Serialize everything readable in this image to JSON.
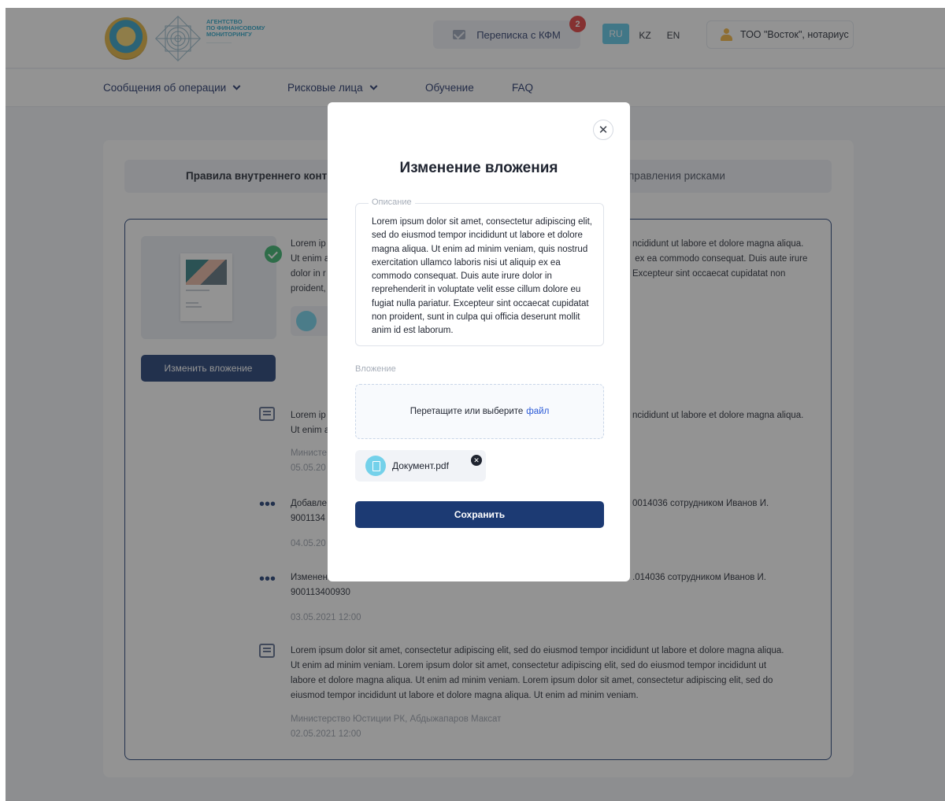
{
  "header": {
    "agency_lines": [
      "АГЕНТСТВО",
      "ПО ФИНАНСОВОМУ",
      "МОНИТОРИНГУ"
    ],
    "kfm_button": "Переписка с КФМ",
    "kfm_badge": "2",
    "languages": {
      "ru": "RU",
      "kz": "KZ",
      "en": "EN",
      "active": "RU"
    },
    "profile": "ТОО \"Восток\", нотариус"
  },
  "nav": {
    "items": [
      {
        "label": "Сообщения об операции"
      },
      {
        "label": "Рисковые лица"
      },
      {
        "label": "Обучение"
      },
      {
        "label": "FAQ"
      }
    ]
  },
  "content": {
    "tab_left": "Правила внутреннего контр",
    "tab_right": "правления рисками",
    "change_button": "Изменить вложение",
    "entries": [
      {
        "left": "Lorem ip\nUt enim a\ndolor in r\nproident,",
        "right": "ncididunt ut labore et dolore magna aliqua.\n ex ea commodo consequat. Duis aute irure\nExcepteur sint occaecat cupidatat non"
      },
      {
        "left": "Lorem ip\nUt enim a",
        "right": "ncididunt ut labore et dolore magna aliqua.",
        "meta": "Министе\n05.05.20"
      },
      {
        "left": "Добавле\n9001134",
        "right": "0014036 сотрудником Иванов И.",
        "meta": "04.05.20"
      },
      {
        "left": "Изменен\n900113400930",
        "right": ".014036 сотрудником Иванов И.",
        "meta": "03.05.2021 12:00"
      },
      {
        "text": "Lorem ipsum dolor sit amet, consectetur adipiscing elit, sed do eiusmod tempor incididunt ut labore et dolore magna aliqua.\nUt enim ad minim veniam. Lorem ipsum dolor sit amet, consectetur adipiscing elit, sed do eiusmod tempor incididunt ut\nlabore et dolore magna aliqua. Ut enim ad minim veniam. Lorem ipsum dolor sit amet, consectetur adipiscing elit, sed do\neiusmod tempor incididunt ut labore et dolore magna aliqua. Ut enim ad minim veniam.",
        "meta": "Министерство Юстиции РК, Абдыжапаров Максат\n02.05.2021 12:00"
      }
    ]
  },
  "modal": {
    "title": "Изменение вложения",
    "description_label": "Описание",
    "description_text": "Lorem ipsum dolor sit amet, consectetur adipiscing elit, sed do eiusmod tempor incididunt ut labore et dolore magna aliqua. Ut enim ad minim veniam, quis nostrud exercitation ullamco laboris nisi ut aliquip ex ea commodo consequat. Duis aute irure dolor in reprehenderit in voluptate velit esse cillum dolore eu fugiat nulla pariatur. Excepteur sint occaecat cupidatat non proident, sunt in culpa qui officia deserunt mollit anim id est laborum.",
    "attachment_label": "Вложение",
    "dropzone_text": "Перетащите или выберите",
    "dropzone_link": "файл",
    "file_name": "Документ.pdf",
    "save_button": "Сохранить"
  },
  "colors": {
    "primary": "#1c3a73",
    "accent": "#5bc6e6",
    "badge": "#e23b3b",
    "success": "#34b36a"
  }
}
